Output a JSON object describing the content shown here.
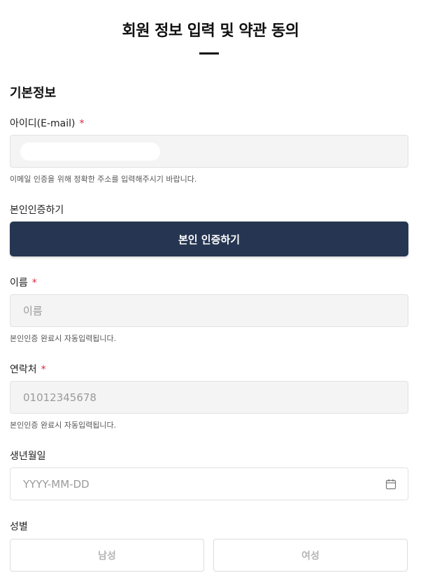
{
  "page": {
    "title": "회원 정보 입력 및 약관 동의"
  },
  "section": {
    "title": "기본정보"
  },
  "email": {
    "label": "아이디(E-mail)",
    "required_mark": "*",
    "value": "",
    "hint": "이메일 인증을 위해 정확한 주소를 입력해주시기 바랍니다."
  },
  "auth": {
    "label": "본인인증하기",
    "button_label": "본인 인증하기",
    "button_color": "#263652"
  },
  "name": {
    "label": "이름",
    "required_mark": "*",
    "placeholder": "이름",
    "hint": "본인인증 완료시 자동입력됩니다."
  },
  "phone": {
    "label": "연락처",
    "required_mark": "*",
    "placeholder": "01012345678",
    "hint": "본인인증 완료시 자동입력됩니다."
  },
  "birth": {
    "label": "생년월일",
    "placeholder": "YYYY-MM-DD",
    "icon": "calendar-icon"
  },
  "gender": {
    "label": "성별",
    "options": [
      "남성",
      "여성"
    ]
  },
  "colors": {
    "required": "#d9263a",
    "field_bg": "#f4f4f4"
  }
}
